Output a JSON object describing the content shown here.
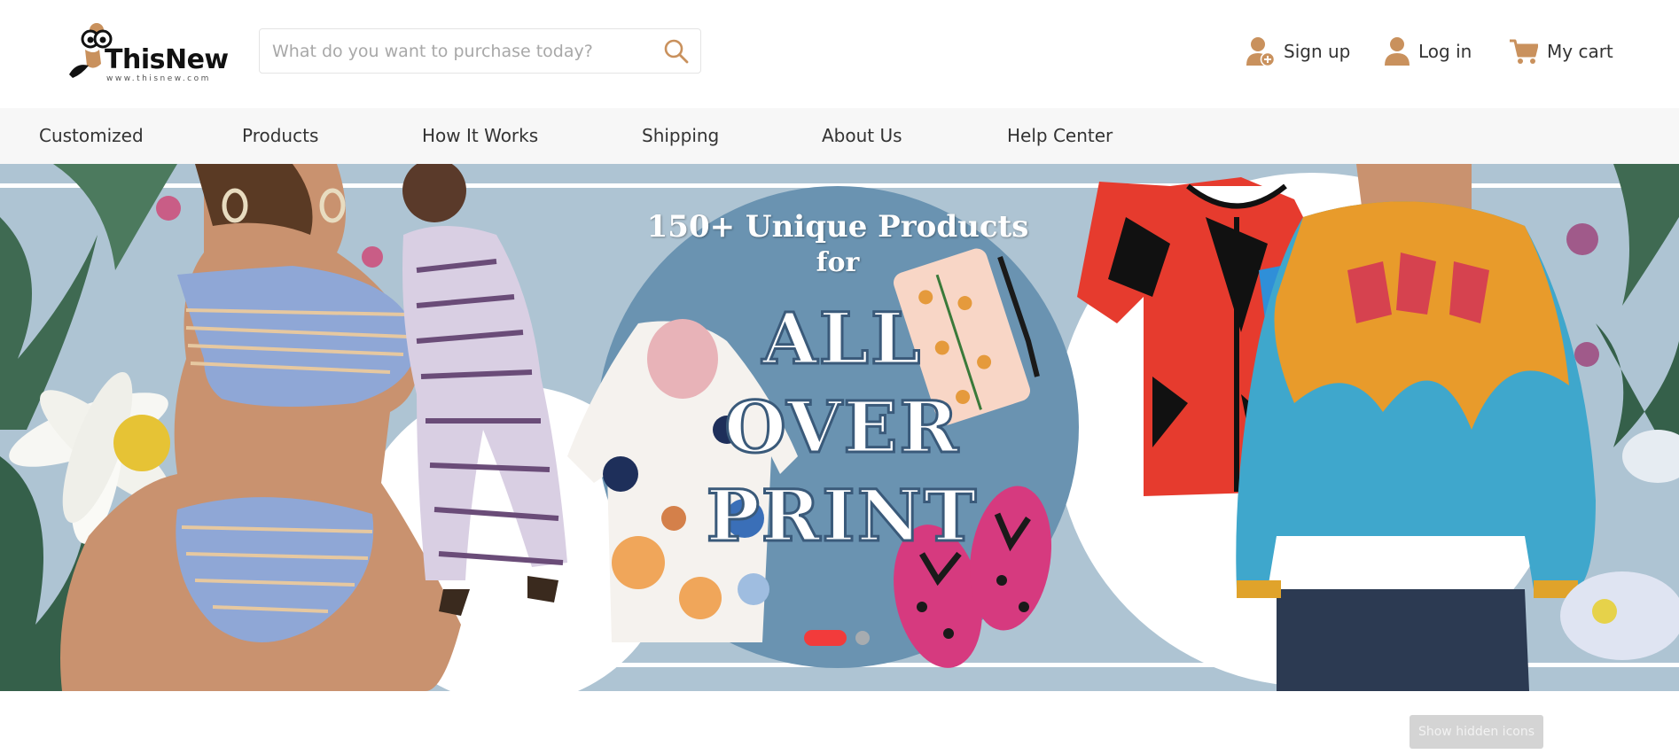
{
  "header": {
    "logo": {
      "name": "ThisNew",
      "url": "www.thisnew.com"
    },
    "search": {
      "placeholder": "What do you want to purchase today?",
      "value": "",
      "icon": "search-icon"
    },
    "links": [
      {
        "label": "Sign up",
        "icon": "user-plus-icon"
      },
      {
        "label": "Log in",
        "icon": "user-icon"
      },
      {
        "label": "My cart",
        "icon": "cart-icon"
      }
    ]
  },
  "nav": {
    "items": [
      {
        "label": "Customized"
      },
      {
        "label": "Products"
      },
      {
        "label": "How It Works"
      },
      {
        "label": "Shipping"
      },
      {
        "label": "About Us"
      },
      {
        "label": "Help Center"
      }
    ]
  },
  "hero": {
    "line1": "150+ Unique Products",
    "line2": "for",
    "big1": "ALL",
    "big2": "OVER",
    "big3": "PRINT",
    "slides_total": 2,
    "active_slide": 1
  },
  "overlay": {
    "show_hidden_icons": "Show hidden icons"
  },
  "colors": {
    "accent": "#c9915d",
    "indicator_active": "#f23b3b",
    "nav_bg": "#f7f7f7",
    "hero_bg": "#aec4d3"
  }
}
